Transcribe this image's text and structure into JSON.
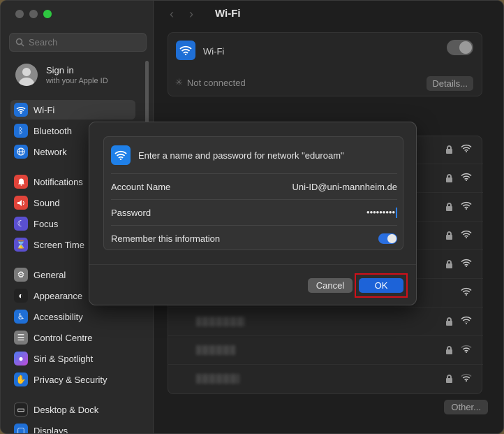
{
  "window": {
    "title": "Wi-Fi"
  },
  "search": {
    "placeholder": "Search"
  },
  "account": {
    "title": "Sign in",
    "subtitle": "with your Apple ID"
  },
  "sidebar": {
    "items": [
      {
        "label": "Wi-Fi",
        "icon": "wifi-icon",
        "color": "#1f6fd6",
        "active": true
      },
      {
        "label": "Bluetooth",
        "icon": "bluetooth-icon",
        "color": "#1f6fd6"
      },
      {
        "label": "Network",
        "icon": "globe-icon",
        "color": "#1f6fd6"
      },
      {
        "label": "Notifications",
        "icon": "bell-icon",
        "color": "#e0443a"
      },
      {
        "label": "Sound",
        "icon": "speaker-icon",
        "color": "#e0443a"
      },
      {
        "label": "Focus",
        "icon": "moon-icon",
        "color": "#5a4fcf"
      },
      {
        "label": "Screen Time",
        "icon": "hourglass-icon",
        "color": "#5a4fcf"
      },
      {
        "label": "General",
        "icon": "gear-icon",
        "color": "#7a7a7a"
      },
      {
        "label": "Appearance",
        "icon": "appearance-icon",
        "color": "#222222"
      },
      {
        "label": "Accessibility",
        "icon": "accessibility-icon",
        "color": "#1f6fd6"
      },
      {
        "label": "Control Centre",
        "icon": "control-centre-icon",
        "color": "#7a7a7a"
      },
      {
        "label": "Siri & Spotlight",
        "icon": "siri-icon",
        "color": "#c04bd6"
      },
      {
        "label": "Privacy & Security",
        "icon": "hand-icon",
        "color": "#1f6fd6"
      },
      {
        "label": "Desktop & Dock",
        "icon": "dock-icon",
        "color": "#222222"
      },
      {
        "label": "Displays",
        "icon": "display-icon",
        "color": "#1f6fd6"
      }
    ]
  },
  "wifi": {
    "label": "Wi-Fi",
    "enabled": false,
    "status": "Not connected",
    "details_label": "Details...",
    "other_label": "Other..."
  },
  "dialog": {
    "title": "Enter a name and password for network \"eduroam\"",
    "account_label": "Account Name",
    "account_value": "Uni-ID@uni-mannheim.de",
    "password_label": "Password",
    "password_value": "•••••••••",
    "remember_label": "Remember this information",
    "remember_enabled": true,
    "cancel_label": "Cancel",
    "ok_label": "OK"
  },
  "colors": {
    "accent": "#1d63d8",
    "highlight": "#d0101a"
  }
}
